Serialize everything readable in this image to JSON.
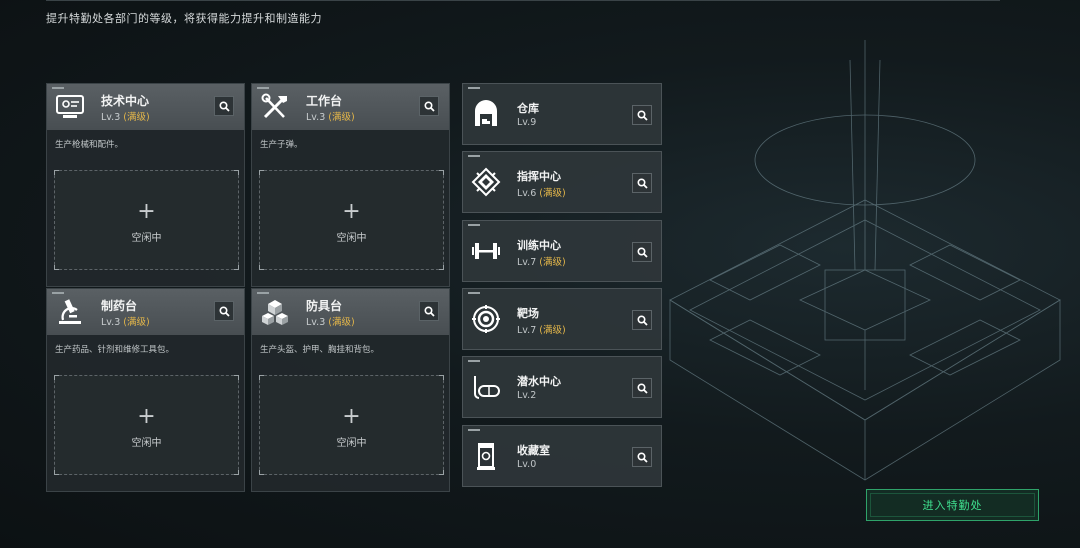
{
  "header": {
    "subtitle": "提升特勤处各部门的等级，将获得能力提升和制造能力"
  },
  "workshops": [
    {
      "name": "技术中心",
      "level": "Lv.3",
      "max_label": "(满级)",
      "desc": "生产枪械和配件。",
      "slot_label": "空闲中",
      "icon": "computer-icon"
    },
    {
      "name": "工作台",
      "level": "Lv.3",
      "max_label": "(满级)",
      "desc": "生产子弹。",
      "slot_label": "空闲中",
      "icon": "tools-icon"
    },
    {
      "name": "制药台",
      "level": "Lv.3",
      "max_label": "(满级)",
      "desc": "生产药品、针剂和维修工具包。",
      "slot_label": "空闲中",
      "icon": "microscope-icon"
    },
    {
      "name": "防具台",
      "level": "Lv.3",
      "max_label": "(满级)",
      "desc": "生产头盔、护甲、胸挂和背包。",
      "slot_label": "空闲中",
      "icon": "cubes-icon"
    }
  ],
  "rooms": [
    {
      "name": "仓库",
      "level": "Lv.9",
      "max_label": "",
      "icon": "warehouse-icon"
    },
    {
      "name": "指挥中心",
      "level": "Lv.6",
      "max_label": "(满级)",
      "icon": "chip-icon"
    },
    {
      "name": "训练中心",
      "level": "Lv.7",
      "max_label": "(满级)",
      "icon": "dumbbell-icon"
    },
    {
      "name": "靶场",
      "level": "Lv.7",
      "max_label": "(满级)",
      "icon": "target-icon"
    },
    {
      "name": "潜水中心",
      "level": "Lv.2",
      "max_label": "",
      "icon": "diving-mask-icon"
    },
    {
      "name": "收藏室",
      "level": "Lv.0",
      "max_label": "",
      "icon": "display-case-icon"
    }
  ],
  "enter_button": {
    "label": "进入特勤处"
  },
  "colors": {
    "accent_max": "#e3b64a",
    "enter_green": "#3fe08f"
  }
}
